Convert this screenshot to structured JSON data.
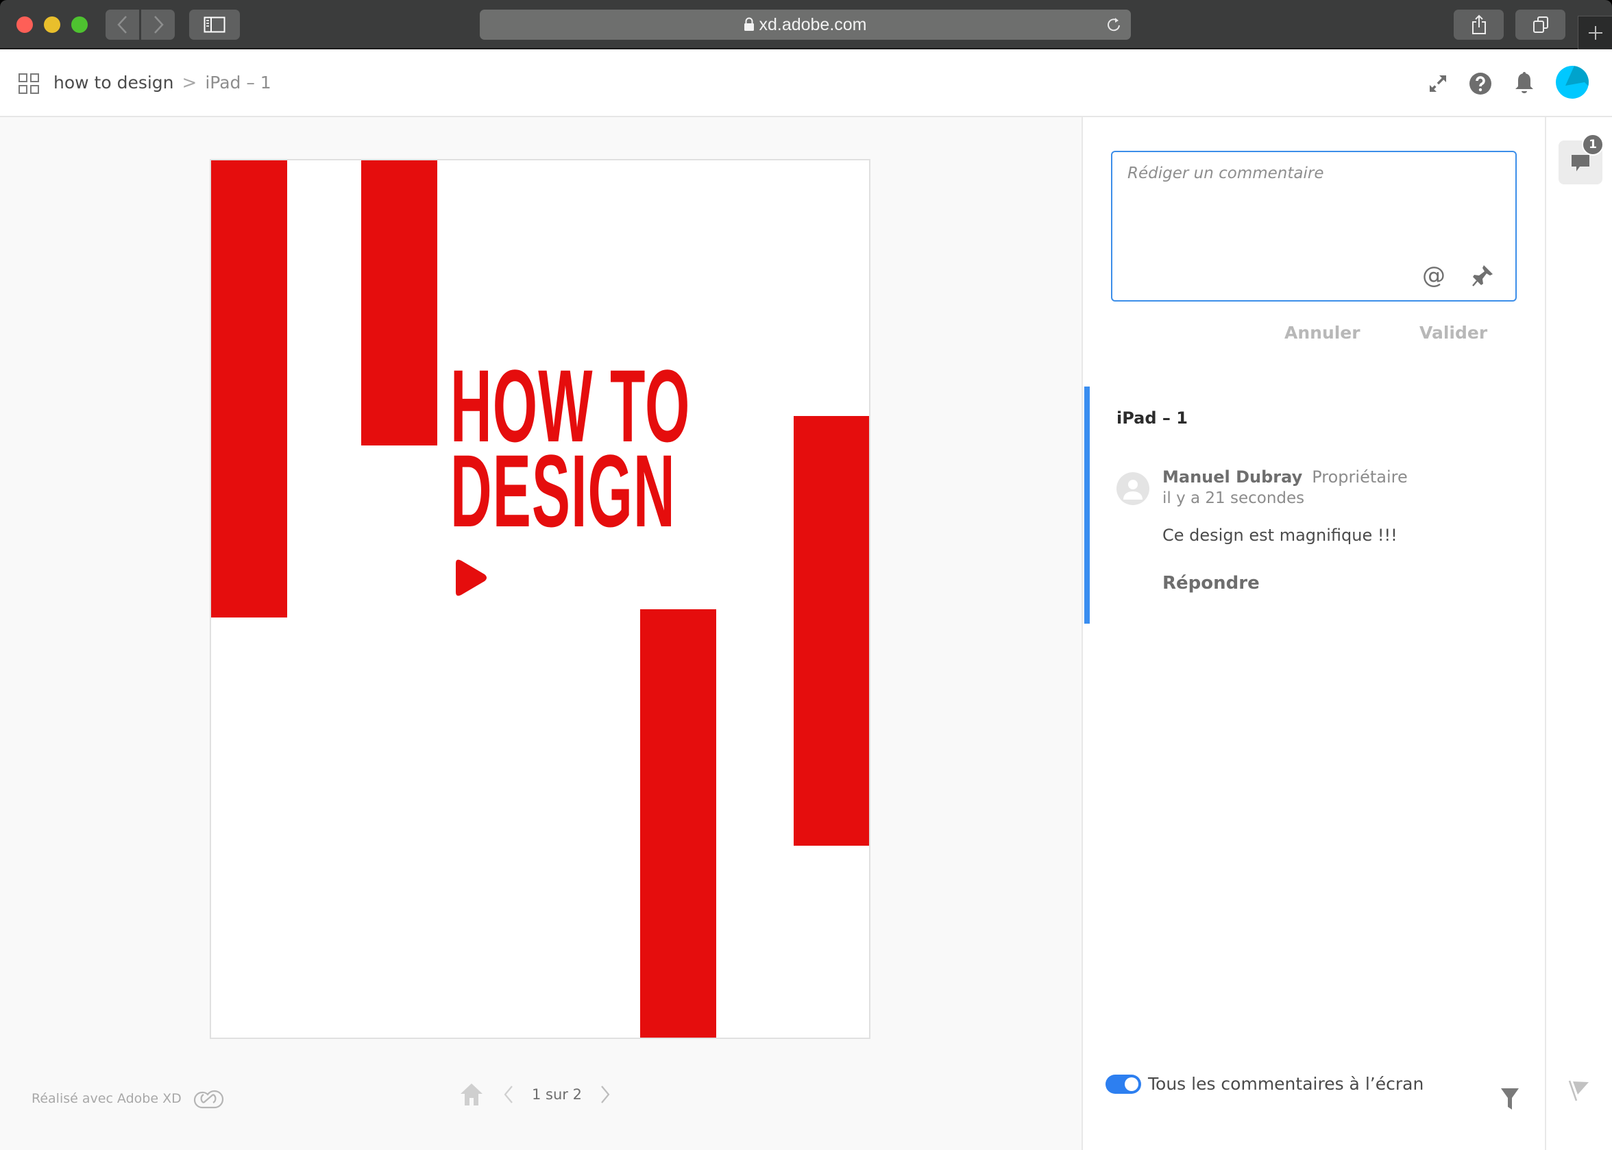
{
  "browser": {
    "url": "xd.adobe.com"
  },
  "header": {
    "breadcrumb": {
      "root": "how to design",
      "separator": ">",
      "current": "iPad – 1"
    },
    "avatar_color": "#00c8ff"
  },
  "artboard": {
    "title_lines": [
      "HOW TO",
      "DESIGN"
    ],
    "accent_color": "#e50d0d"
  },
  "footer": {
    "made_with": "Réalisé avec Adobe XD",
    "page_label": "1 sur 2",
    "current_page": 1,
    "total_pages": 2
  },
  "comments": {
    "input_placeholder": "Rédiger un commentaire",
    "input_value": "",
    "cancel_label": "Annuler",
    "submit_label": "Valider",
    "mention_symbol": "@",
    "thread": {
      "title": "iPad – 1",
      "author": "Manuel Dubray",
      "role": "Propriétaire",
      "time": "il y a 21 secondes",
      "text": "Ce design est magnifique !!!",
      "reply_label": "Répondre"
    },
    "toggle_label": "Tous les commentaires à l’écran",
    "toggle_on": true,
    "accent_color": "#3a8ef0"
  },
  "rail": {
    "comment_count": "1"
  }
}
